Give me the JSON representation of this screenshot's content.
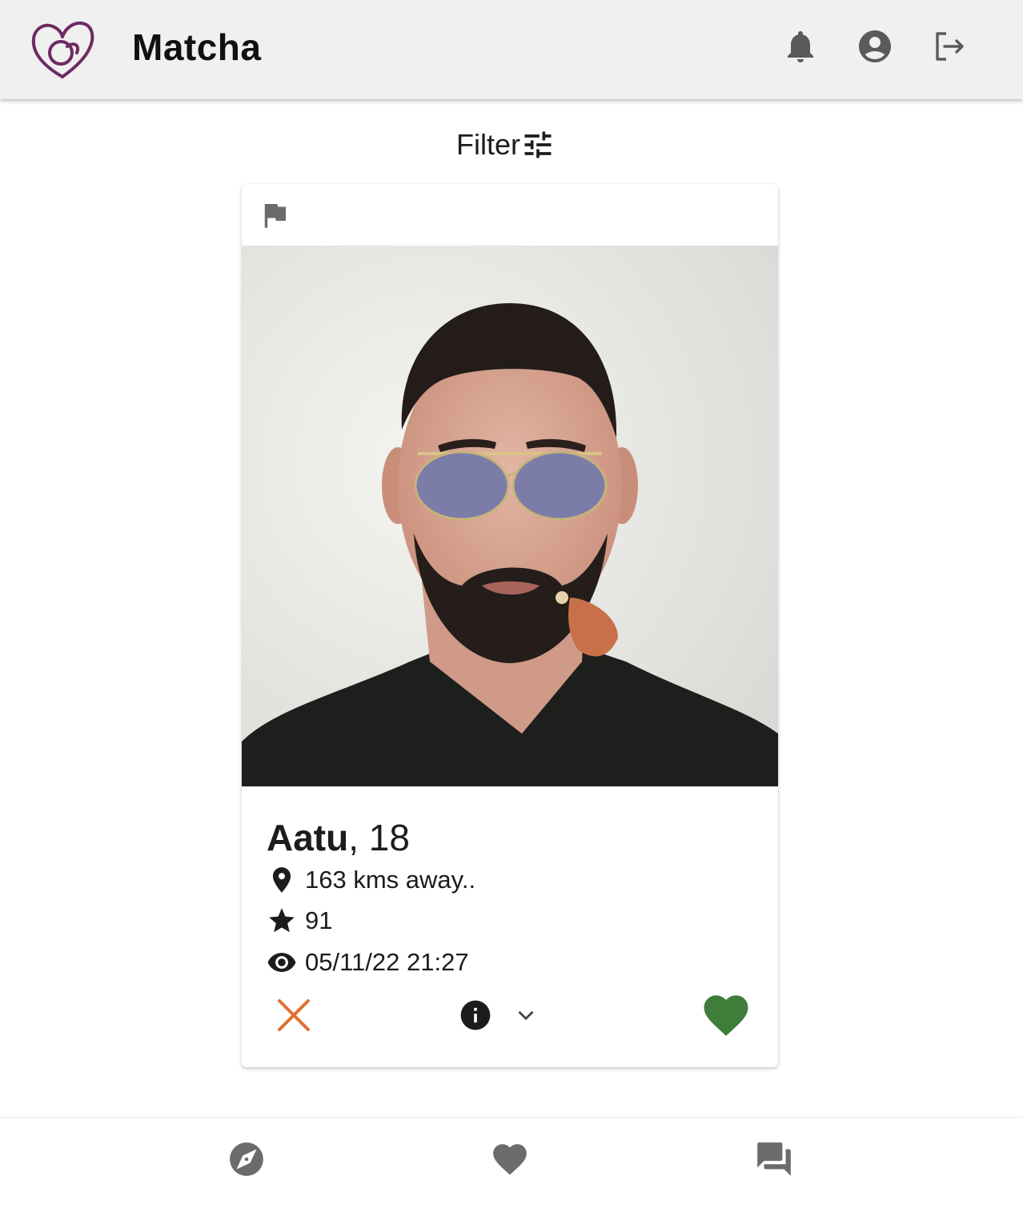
{
  "header": {
    "app_name": "Matcha",
    "logo_color": "#6e2a63"
  },
  "filter": {
    "label": "Filter"
  },
  "profile": {
    "name": "Aatu",
    "age_text": ", 18",
    "distance": "163 kms away..",
    "rating": "91",
    "last_seen": "05/11/22 21:27"
  },
  "colors": {
    "dislike": "#e07030",
    "like": "#3f7d3a",
    "icon_gray": "#6b6b6b",
    "header_bg": "#f0f0f0"
  },
  "icons": {
    "notifications": "bell-icon",
    "profile": "account-circle-icon",
    "logout": "logout-icon",
    "filter": "tune-icon",
    "report": "flag-icon",
    "location": "location-pin-icon",
    "rating": "star-icon",
    "last_seen": "eye-icon",
    "dislike": "close-icon",
    "info": "info-icon",
    "expand": "chevron-down-icon",
    "like": "heart-icon",
    "nav_explore": "compass-icon",
    "nav_likes": "heart-icon",
    "nav_chat": "forum-icon"
  }
}
